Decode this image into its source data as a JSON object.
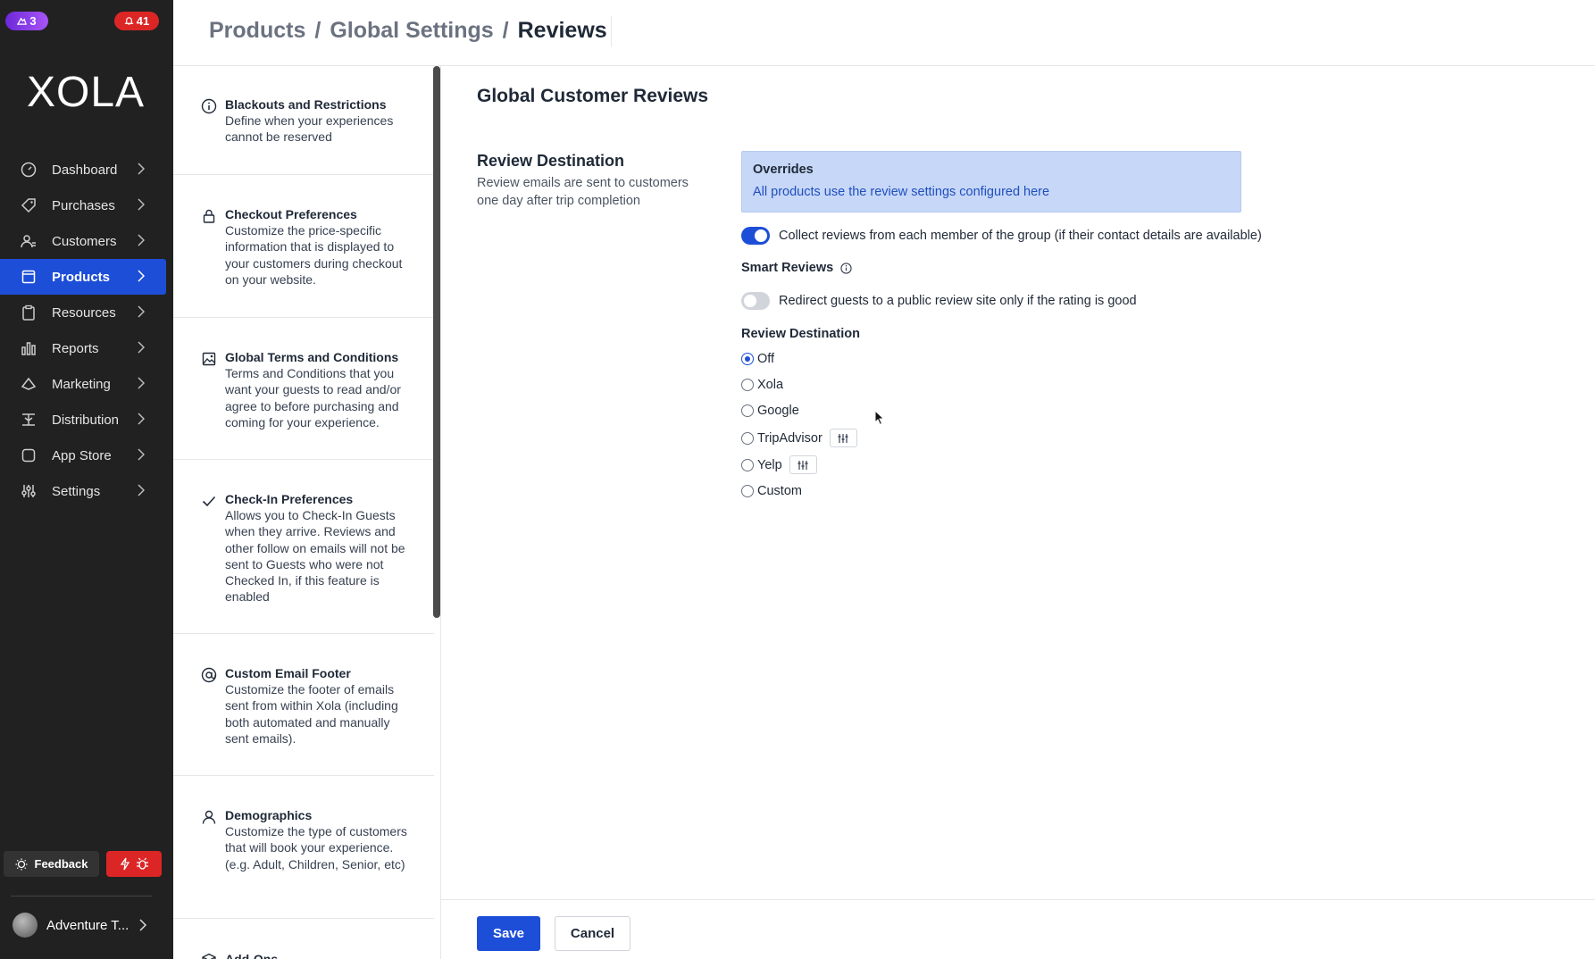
{
  "badges": {
    "left": "3",
    "right": "41"
  },
  "brand": {
    "logo": "XOLA"
  },
  "nav": [
    {
      "label": "Dashboard",
      "icon": "dashboard-icon"
    },
    {
      "label": "Purchases",
      "icon": "tag-icon"
    },
    {
      "label": "Customers",
      "icon": "customers-icon"
    },
    {
      "label": "Products",
      "icon": "products-icon",
      "active": true
    },
    {
      "label": "Resources",
      "icon": "clipboard-icon"
    },
    {
      "label": "Reports",
      "icon": "bar-chart-icon"
    },
    {
      "label": "Marketing",
      "icon": "megaphone-icon"
    },
    {
      "label": "Distribution",
      "icon": "distribution-icon"
    },
    {
      "label": "App Store",
      "icon": "app-store-icon"
    },
    {
      "label": "Settings",
      "icon": "sliders-icon"
    }
  ],
  "feedback": {
    "label": "Feedback"
  },
  "account": {
    "name": "Adventure T..."
  },
  "breadcrumb": {
    "part1": "Products",
    "sep": "/",
    "part2": "Global Settings",
    "current": "Reviews"
  },
  "settings_list": [
    {
      "title": "Blackouts and Restrictions",
      "desc": "Define when your experiences cannot be reserved",
      "icon": "info-icon"
    },
    {
      "title": "Checkout Preferences",
      "desc": "Customize the price-specific information that is displayed to your customers during checkout on your website.",
      "icon": "lock-icon"
    },
    {
      "title": "Global Terms and Conditions",
      "desc": "Terms and Conditions that you want your guests to read and/or agree to before purchasing and coming for your experience.",
      "icon": "image-icon"
    },
    {
      "title": "Check-In Preferences",
      "desc": "Allows you to Check-In Guests when they arrive. Reviews and other follow on emails will not be sent to Guests who were not Checked In, if this feature is enabled",
      "icon": "check-icon"
    },
    {
      "title": "Custom Email Footer",
      "desc": "Customize the footer of emails sent from within Xola (including both automated and manually sent emails).",
      "icon": "at-sign-icon"
    },
    {
      "title": "Demographics",
      "desc": "Customize the type of customers that will book your experience. (e.g. Adult, Children, Senior, etc)",
      "icon": "user-icon"
    },
    {
      "title": "Add-Ons",
      "desc": "",
      "icon": "box-icon"
    }
  ],
  "main": {
    "title": "Global Customer Reviews",
    "section_title": "Review Destination",
    "section_desc": "Review emails are sent to customers one day after trip completion",
    "overrides_title": "Overrides",
    "overrides_link": "All products use the review settings configured here",
    "collect_label": "Collect reviews from each member of the group (if their contact details are available)",
    "collect_on": true,
    "smart_reviews_label": "Smart Reviews",
    "redirect_label": "Redirect guests to a public review site only if the rating is good",
    "redirect_on": false,
    "destination_label": "Review Destination",
    "destinations": [
      {
        "label": "Off",
        "checked": true
      },
      {
        "label": "Xola",
        "checked": false
      },
      {
        "label": "Google",
        "checked": false
      },
      {
        "label": "TripAdvisor",
        "checked": false
      },
      {
        "label": "Yelp",
        "checked": false
      },
      {
        "label": "Custom",
        "checked": false
      }
    ]
  },
  "footer": {
    "save": "Save",
    "cancel": "Cancel"
  },
  "colors": {
    "primary": "#1d4ed8",
    "sidebar": "#212121",
    "danger": "#dc2626",
    "overrides_bg": "#c7d7f7"
  }
}
